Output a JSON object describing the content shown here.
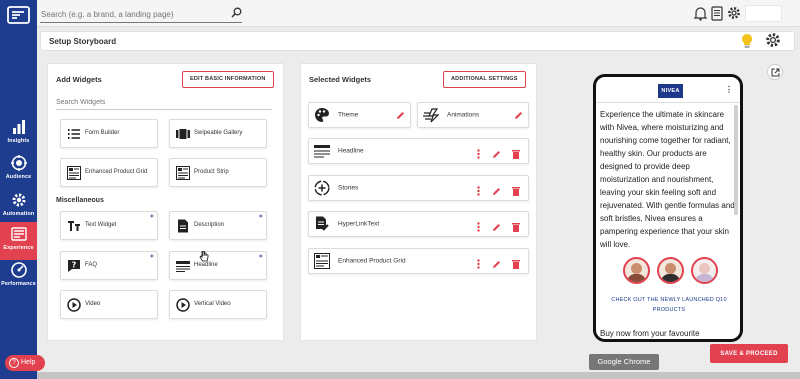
{
  "search": {
    "placeholder": "Search (e.g. a brand, a landing page)"
  },
  "header": {
    "title": "Setup Storyboard"
  },
  "nav": [
    {
      "label": "Insights",
      "icon": "bar-chart-icon"
    },
    {
      "label": "Audience",
      "icon": "target-icon"
    },
    {
      "label": "Automation",
      "icon": "gear-icon"
    },
    {
      "label": "Experience",
      "icon": "layout-icon",
      "active": true
    },
    {
      "label": "Performance",
      "icon": "gauge-icon"
    }
  ],
  "add_panel": {
    "title": "Add Widgets",
    "button": "EDIT BASIC INFORMATION",
    "search_placeholder": "Search Widgets",
    "widgets": [
      {
        "label": "Form Builder",
        "icon": "list-icon"
      },
      {
        "label": "Swipeable Gallery",
        "icon": "gallery-icon"
      },
      {
        "label": "Enhanced Product Grid",
        "icon": "product-grid-icon"
      },
      {
        "label": "Product Strip",
        "icon": "product-strip-icon"
      }
    ],
    "misc_title": "Miscellaneous",
    "misc": [
      {
        "label": "Text Widget",
        "icon": "text-icon"
      },
      {
        "label": "Description",
        "icon": "document-icon"
      },
      {
        "label": "FAQ",
        "icon": "faq-icon"
      },
      {
        "label": "Headline",
        "icon": "headline-icon"
      },
      {
        "label": "Video",
        "icon": "play-icon"
      },
      {
        "label": "Vertical Video",
        "icon": "play-icon"
      }
    ]
  },
  "selected_panel": {
    "title": "Selected Widgets",
    "button": "ADDITIONAL SETTINGS",
    "top": [
      {
        "label": "Theme",
        "icon": "palette-icon"
      },
      {
        "label": "Animations",
        "icon": "animation-icon"
      }
    ],
    "items": [
      {
        "label": "Headline",
        "icon": "headline-icon"
      },
      {
        "label": "Stories",
        "icon": "stories-icon"
      },
      {
        "label": "HyperLinkText",
        "icon": "hyperlink-icon"
      },
      {
        "label": "Enhanced Product Grid",
        "icon": "product-grid-icon"
      }
    ]
  },
  "preview": {
    "brand": "NIVEA",
    "copy": "Experience the ultimate in skincare with Nivea, where moisturizing and nourishing come together for radiant, healthy skin. Our products are designed to provide deep moisturization and nourishment, leaving your skin feeling soft and rejuvenated. With gentle formulas and soft bristles, Nivea ensures a pampering experience that your skin will love.",
    "cta": "CHECK OUT THE NEWLY LAUNCHED Q10 PRODUCTS",
    "cut_text": "Buy now from your favourite"
  },
  "actions": {
    "save_proceed": "SAVE & PROCEED",
    "help": "Help"
  },
  "tooltip": "Google Chrome",
  "colors": {
    "rail": "#1f3d8f",
    "accent": "#e2424f",
    "brand": "#1d3a8a"
  }
}
